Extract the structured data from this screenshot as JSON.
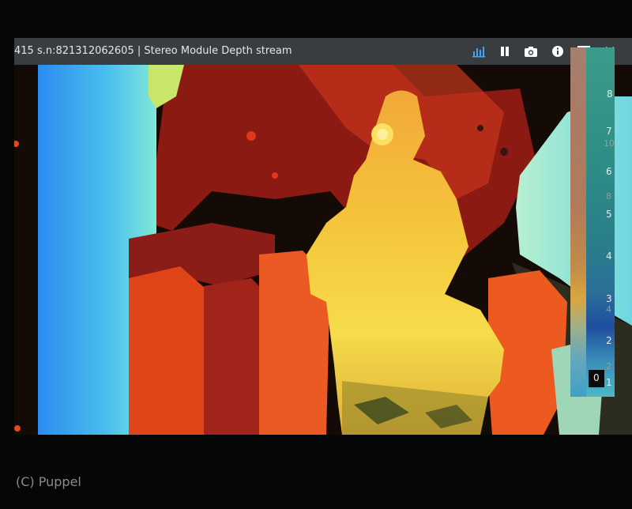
{
  "window": {
    "title": "415 s.n:821312062605 | Stereo Module Depth stream"
  },
  "toolbar": {
    "icons": [
      "bar-chart-icon",
      "pause-icon",
      "camera-icon",
      "info-icon",
      "maximize-icon",
      "close-icon"
    ]
  },
  "depth_scale": {
    "primary_ticks": [
      "8",
      "7",
      "6",
      "5",
      "4",
      "3",
      "2",
      "1",
      "0"
    ],
    "secondary_ticks": [
      "10",
      "8",
      "4",
      "2"
    ]
  },
  "watermark": "(C) Puppel",
  "colors": {
    "titlebar": "#3a3d40",
    "near": "#f0d23a",
    "mid": "#e8501c",
    "far_red": "#9a1c14",
    "far_cyan": "#57d3e6",
    "far_blue": "#2a8cf0"
  }
}
